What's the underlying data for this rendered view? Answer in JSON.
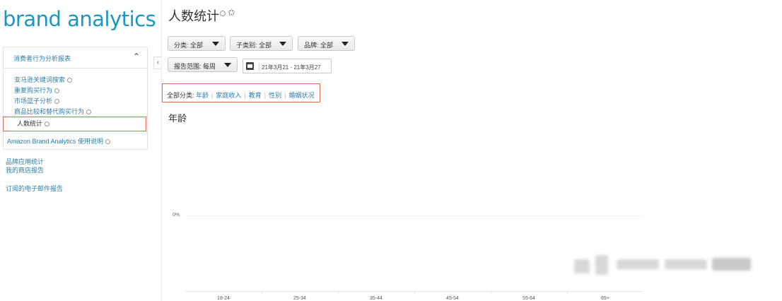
{
  "app": {
    "logo_text": "brand analytics"
  },
  "sidebar": {
    "panel_title": "消费者行为分析报表",
    "items": [
      {
        "label": "亚马逊关键词搜索"
      },
      {
        "label": "重复购买行为"
      },
      {
        "label": "市场篮子分析"
      },
      {
        "label": "商品比较和替代购买行为"
      },
      {
        "label": "人数统计"
      },
      {
        "label": "Amazon Brand Analytics 使用说明"
      }
    ],
    "links": [
      {
        "label": "品牌应用统计"
      },
      {
        "label": "我的商店报告"
      },
      {
        "label": "订阅的电子邮件报告"
      }
    ]
  },
  "header": {
    "title": "人数统计"
  },
  "filters": {
    "dropdowns": [
      {
        "label": "分类: 全部"
      },
      {
        "label": "子类别: 全部"
      },
      {
        "label": "品牌: 全部"
      },
      {
        "label": "报告范围: 每周"
      }
    ],
    "date_range": "21年3月21 - 21年3月27"
  },
  "tabs": {
    "prefix": "全部分类:",
    "items": [
      "年龄",
      "家庭收入",
      "教育",
      "性别",
      "婚姻状况"
    ]
  },
  "chart_data": {
    "type": "bar",
    "title": "年龄",
    "categories": [
      "18-24",
      "25-34",
      "35-44",
      "45-54",
      "55-64",
      "65+"
    ],
    "values": [],
    "y_tick_labels": [
      "0%"
    ],
    "grid": false
  }
}
